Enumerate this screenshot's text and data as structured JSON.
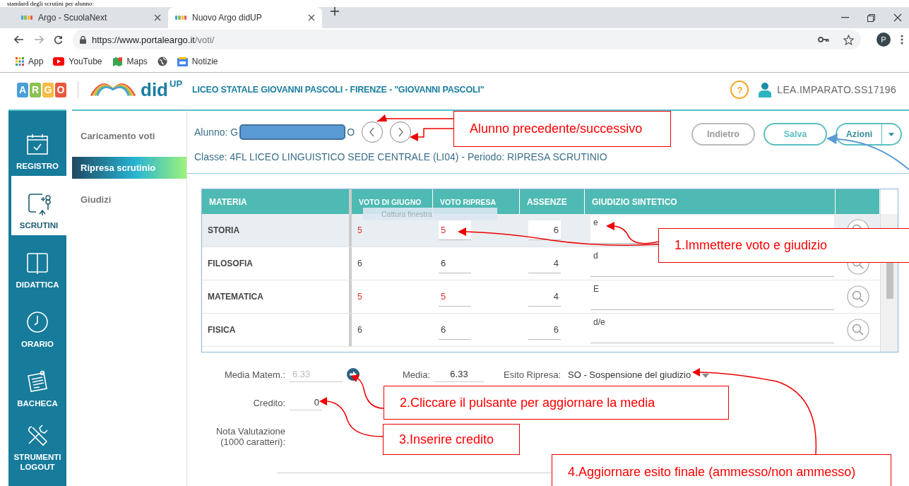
{
  "document_heading": "standard degli scrutini per alunno:",
  "browser": {
    "tabs": [
      {
        "title": "Argo - ScuolaNext",
        "selected": false
      },
      {
        "title": "Nuovo Argo didUP",
        "selected": true
      }
    ],
    "url": {
      "host": "https://www.portaleargo.it",
      "path": "/voti/"
    },
    "profile_initial": "P",
    "bookmarks": [
      {
        "kind": "apps",
        "label": "App"
      },
      {
        "kind": "video",
        "label": "YouTube"
      },
      {
        "kind": "map",
        "label": "Maps"
      },
      {
        "kind": "globe"
      },
      {
        "kind": "news",
        "label": "Notizie"
      }
    ]
  },
  "app_header": {
    "logo_letters": [
      "A",
      "R",
      "G",
      "O"
    ],
    "product": "did",
    "product_sup": "UP",
    "school": "LICEO STATALE GIOVANNI PASCOLI - FIRENZE - \"GIOVANNI PASCOLI\"",
    "help": "?",
    "user": "LEA.IMPARATO.SS17196"
  },
  "nav": [
    {
      "kind": "calendar",
      "label": "REGISTRO",
      "selected": false
    },
    {
      "kind": "grades",
      "label": "SCRUTINI",
      "selected": true
    },
    {
      "kind": "book",
      "label": "DIDATTICA",
      "selected": false
    },
    {
      "kind": "clock",
      "label": "ORARIO",
      "selected": false
    },
    {
      "kind": "board",
      "label": "BACHECA",
      "selected": false
    },
    {
      "kind": "tools",
      "label": "STRUMENTI",
      "selected": false
    },
    {
      "kind": "plain",
      "label": "LOGOUT",
      "selected": false
    }
  ],
  "submenu": [
    {
      "label": "Caricamento voti",
      "selected": false
    },
    {
      "label": "Ripresa scrutinio",
      "selected": true
    },
    {
      "label": "Giudizi",
      "selected": false
    }
  ],
  "student": {
    "label": "Alunno: G",
    "name_end": "O",
    "class_line": "Classe: 4FL LICEO LINGUISTICO SEDE CENTRALE (LI04) - Periodo: RIPRESA SCRUTINIO"
  },
  "buttons": [
    {
      "label": "Indietro",
      "kind": "plain"
    },
    {
      "label": "Salva",
      "kind": "primary"
    },
    {
      "label": "Azioni",
      "kind": "split"
    }
  ],
  "table": {
    "columns": [
      "MATERIA",
      "VOTO DI GIUGNO",
      "VOTO RIPRESA",
      "ASSENZE",
      "GIUDIZIO SINTETICO"
    ],
    "rows": [
      {
        "materia": "STORIA",
        "voto_giugno": "5",
        "voto_ripresa": "5",
        "insufficiente": true,
        "assenze": "6",
        "giudizio": "e",
        "selected": true
      },
      {
        "materia": "FILOSOFIA",
        "voto_giugno": "6",
        "voto_ripresa": "6",
        "insufficiente": false,
        "assenze": "4",
        "giudizio": "d",
        "selected": false
      },
      {
        "materia": "MATEMATICA",
        "voto_giugno": "5",
        "voto_ripresa": "5",
        "insufficiente": true,
        "assenze": "4",
        "giudizio": "E",
        "selected": false
      },
      {
        "materia": "FISICA",
        "voto_giugno": "6",
        "voto_ripresa": "6",
        "insufficiente": false,
        "assenze": "6",
        "giudizio": "d/e",
        "selected": false
      }
    ]
  },
  "tooltip": "Cattura finestra",
  "summary": {
    "media_matem_label": "Media Matem.:",
    "media_matem": "6.33",
    "media_label": "Media:",
    "media": "6.33",
    "esito_label": "Esito Ripresa:",
    "esito": "SO - Sospensione del giudizio",
    "credito_label": "Credito:",
    "credito": "0",
    "nota_label": "Nota Valutazione\n(1000 caratteri):"
  },
  "annotations": [
    "Alunno precedente/successivo",
    "1.Immettere voto e giudizio",
    "2.Cliccare il pulsante per aggiornare la media",
    "3.Inserire credito",
    "4.Aggiornare esito finale (ammesso/non ammesso)"
  ]
}
